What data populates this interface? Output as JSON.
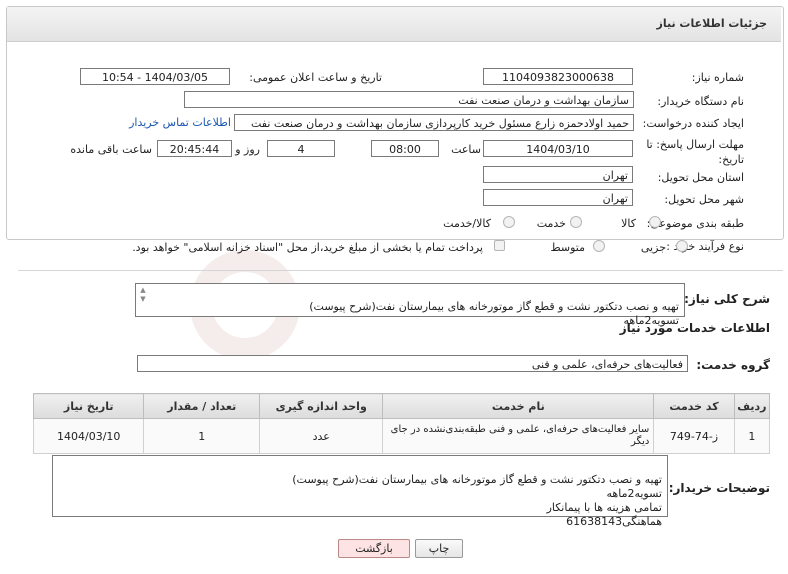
{
  "header": {
    "title": "جزئیات اطلاعات نیاز"
  },
  "form": {
    "need_number_label": "شماره نیاز:",
    "need_number": "1104093823000638",
    "announce_label": "تاریخ و ساعت اعلان عمومی:",
    "announce_value": "1404/03/05 - 10:54",
    "buyer_org_label": "نام دستگاه خریدار:",
    "buyer_org": "سازمان بهداشت و درمان صنعت نفت",
    "creator_label": "ایجاد کننده درخواست:",
    "creator": "حمید اولادحمزه زارع مسئول خرید کارپردازی سازمان بهداشت و درمان صنعت نفت",
    "contact_link": "اطلاعات تماس خریدار",
    "deadline_label": "مهلت ارسال پاسخ: تا تاریخ:",
    "deadline_date": "1404/03/10",
    "time_label": "ساعت",
    "deadline_time": "08:00",
    "days_value": "4",
    "days_label": "روز و",
    "remaining_time": "20:45:44",
    "remaining_label": "ساعت باقی مانده",
    "province_label": "استان محل تحویل:",
    "province": "تهران",
    "city_label": "شهر محل تحویل:",
    "city": "تهران",
    "category_label": "طبقه بندی موضوعی:",
    "category_options": [
      "کالا",
      "خدمت",
      "کالا/خدمت"
    ],
    "process_label": "نوع فرآیند خرید :",
    "process_options": [
      "جزیی",
      "متوسط"
    ],
    "payment_note": "پرداخت تمام یا بخشی از مبلغ خرید،از محل \"اسناد خزانه اسلامی\" خواهد بود."
  },
  "details": {
    "general_desc_label": "شرح کلی نیاز:",
    "general_desc": "تهیه و نصب دتکتور نشت و قطع گاز موتورخانه های بیمارستان نفت(شرح پیوست)\nتسویه2ماهه",
    "services_heading": "اطلاعات خدمات مورد نیاز",
    "service_group_label": "گروه خدمت:",
    "service_group": "فعالیت‌های حرفه‌ای، علمی و فنی"
  },
  "table": {
    "headers": [
      "ردیف",
      "کد خدمت",
      "نام خدمت",
      "واحد اندازه گیری",
      "تعداد / مقدار",
      "تاریخ نیاز"
    ],
    "rows": [
      [
        "1",
        "ز-74-749",
        "سایر فعالیت‌های حرفه‌ای، علمی و فنی طبقه‌بندی‌نشده در جای دیگر",
        "عدد",
        "1",
        "1404/03/10"
      ]
    ]
  },
  "buyer_notes": {
    "label": "توضیحات خریدار:",
    "text": "تهیه و نصب دتکتور نشت و قطع گاز موتورخانه های بیمارستان نفت(شرح پیوست)\nتسویه2ماهه\nتمامی هزینه ها با پیمانکار\nهماهنگی61638143"
  },
  "buttons": {
    "print": "چاپ",
    "back": "بازگشت"
  },
  "colors": {
    "link": "#1a56b0",
    "back_button_bg": "#fde3e3"
  }
}
